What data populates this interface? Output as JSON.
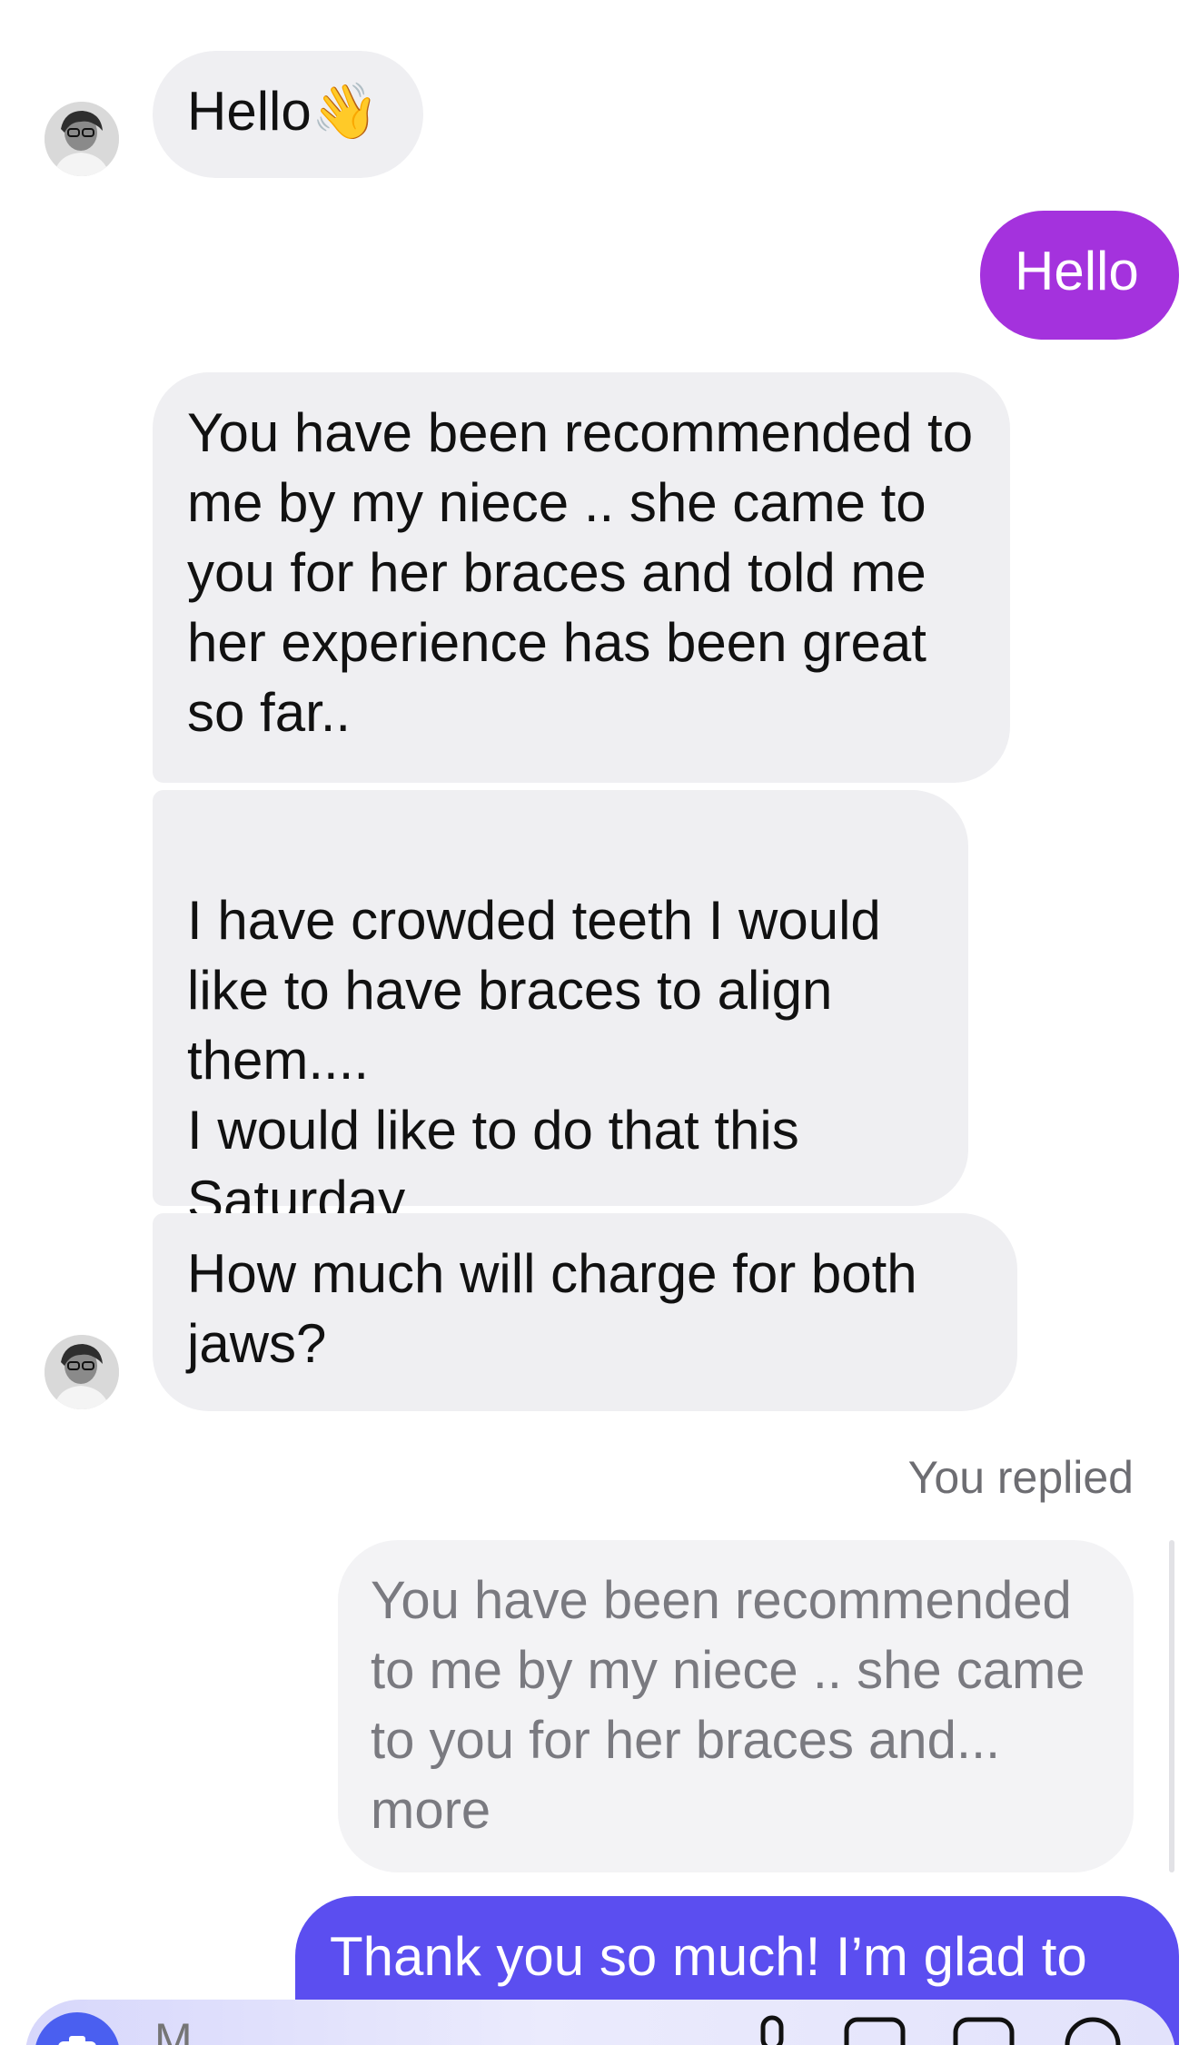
{
  "messages": [
    {
      "id": "m1",
      "from": "them",
      "text": "Hello👋"
    },
    {
      "id": "m2",
      "from": "me",
      "text": "Hello"
    },
    {
      "id": "m3",
      "from": "them",
      "text": "You have been recommended to me by my niece .. she came to you for her braces and told me her experience has been great so far.."
    },
    {
      "id": "m4",
      "from": "them",
      "text": "I have crowded teeth I would like to have braces to align them....\nI would like to do that this Saturday"
    },
    {
      "id": "m5",
      "from": "them",
      "text": "How much will charge for both jaws?"
    }
  ],
  "reply": {
    "label": "You replied",
    "quoted_text": "You have been recommended to me by my niece .. she came to you for her braces and...",
    "more_label": "more",
    "text": "Thank you so much! I’m glad to"
  },
  "composer": {
    "placeholder": "M"
  },
  "colors": {
    "incoming_bubble": "#efeff2",
    "outgoing_purple": "#a432dd",
    "outgoing_blue": "#5b4ef0",
    "camera_button": "#4a5ff0"
  },
  "icons": {
    "avatar": "contact-avatar",
    "camera": "camera-icon",
    "mic": "microphone-icon",
    "gallery": "gallery-icon",
    "sticker": "sticker-icon",
    "emoji": "emoji-icon"
  }
}
